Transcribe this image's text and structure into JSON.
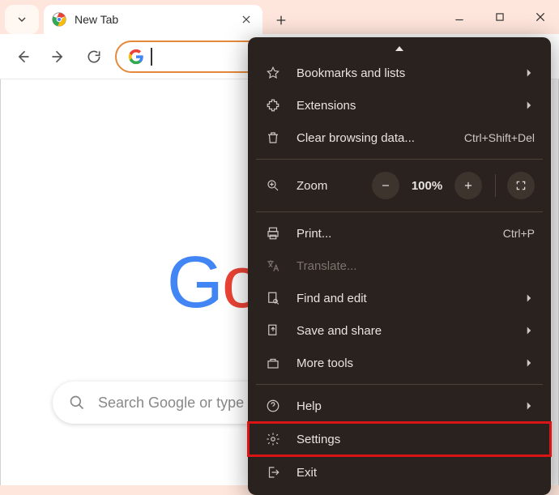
{
  "tab": {
    "title": "New Tab"
  },
  "search": {
    "placeholder": "Search Google or type a URL"
  },
  "menu": {
    "bookmarks": "Bookmarks and lists",
    "extensions": "Extensions",
    "clear_browsing": "Clear browsing data...",
    "clear_browsing_shortcut": "Ctrl+Shift+Del",
    "zoom_label": "Zoom",
    "zoom_value": "100%",
    "print": "Print...",
    "print_shortcut": "Ctrl+P",
    "translate": "Translate...",
    "find_edit": "Find and edit",
    "save_share": "Save and share",
    "more_tools": "More tools",
    "help": "Help",
    "settings": "Settings",
    "exit": "Exit"
  }
}
